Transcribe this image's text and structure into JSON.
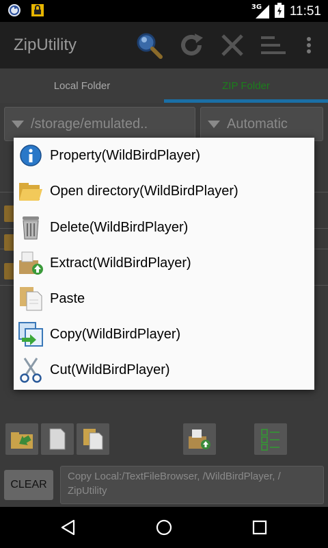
{
  "status_bar": {
    "network": "3G",
    "time": "11:51",
    "left_icons": [
      "sync-icon",
      "lock-icon"
    ],
    "right_icons": [
      "signal-icon",
      "battery-icon"
    ]
  },
  "action_bar": {
    "title": "ZipUtility",
    "icons": [
      "search-icon",
      "refresh-icon",
      "close-icon",
      "sort-icon",
      "overflow-menu-icon"
    ]
  },
  "tabs": [
    {
      "label": "Local Folder",
      "active": false
    },
    {
      "label": "ZIP Folder",
      "active": true
    }
  ],
  "path_spinner": {
    "value": "/storage/emulated.."
  },
  "mode_spinner": {
    "value": "Automatic"
  },
  "context_menu": {
    "items": [
      {
        "label": "Property(WildBirdPlayer)",
        "icon": "info-icon"
      },
      {
        "label": "Open directory(WildBirdPlayer)",
        "icon": "folder-open-icon"
      },
      {
        "label": "Delete(WildBirdPlayer)",
        "icon": "trash-icon"
      },
      {
        "label": "Extract(WildBirdPlayer)",
        "icon": "extract-icon"
      },
      {
        "label": "Paste",
        "icon": "paste-icon"
      },
      {
        "label": "Copy(WildBirdPlayer)",
        "icon": "copy-icon"
      },
      {
        "label": "Cut(WildBirdPlayer)",
        "icon": "scissors-icon"
      }
    ]
  },
  "bottom_toolbar": {
    "icons": [
      "folder-upload-icon",
      "new-file-icon",
      "paste-icon",
      "extract-icon",
      "checklist-icon"
    ]
  },
  "clipboard": {
    "clear_label": "CLEAR",
    "text": "Copy Local:/TextFileBrowser, /WildBirdPlayer, / ZipUtility"
  },
  "nav_bar": {
    "icons": [
      "back-icon",
      "home-icon",
      "recents-icon"
    ]
  },
  "colors": {
    "accent": "#1a6fa6",
    "active_tab_text": "#1b7f1b",
    "menu_background": "#fafafa"
  }
}
